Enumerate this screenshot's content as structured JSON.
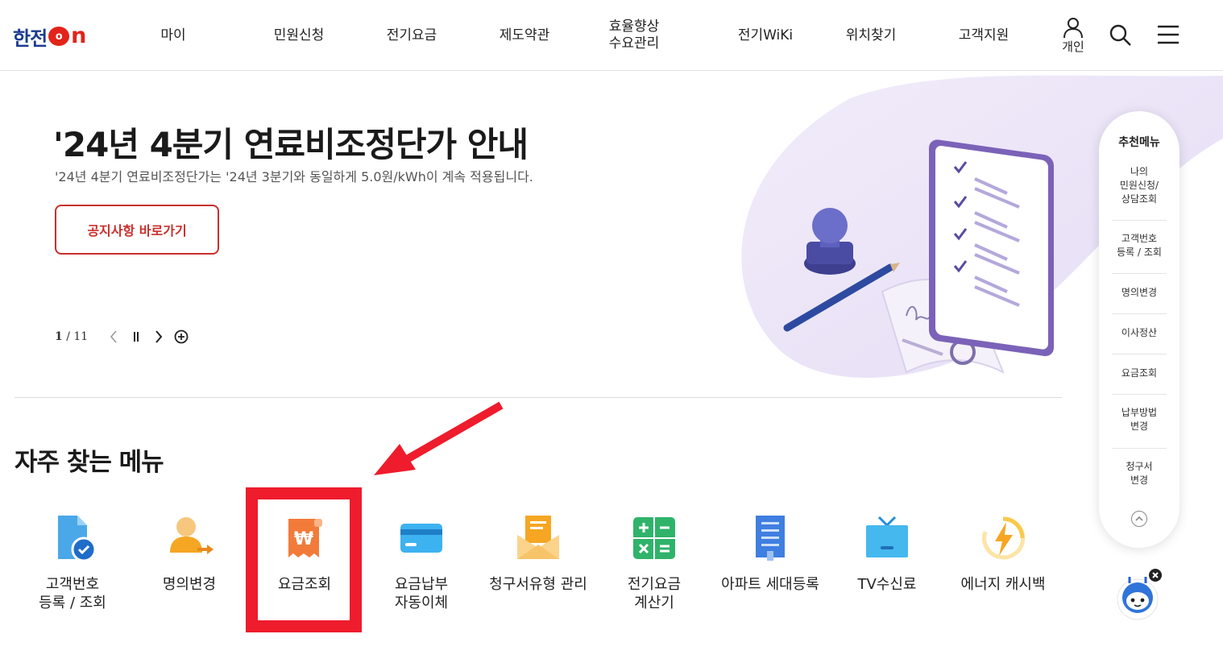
{
  "header": {
    "logo_text": "한전",
    "logo_on_o": "o",
    "logo_on_n": "n",
    "nav": [
      "마이",
      "민원신청",
      "전기요금",
      "제도약관",
      "효율향상\n수요관리",
      "전기WiKi",
      "위치찾기",
      "고객지원"
    ],
    "user_label": "개인",
    "icons": {
      "user": "user-icon",
      "search": "search-icon",
      "menu": "hamburger-menu-icon"
    }
  },
  "hero": {
    "title": "'24년 4분기 연료비조정단가 안내",
    "subtitle": "'24년 4분기 연료비조정단가는 '24년 3분기와 동일하게 5.0원/kWh이 계속 적용됩니다.",
    "button": "공지사항 바로가기",
    "pager": {
      "current": "1",
      "separator": "/",
      "total": "11"
    }
  },
  "quick_menu": {
    "title": "자주 찾는 메뉴",
    "items": [
      {
        "label": "고객번호\n등록 / 조회",
        "icon": "document-check-icon"
      },
      {
        "label": "명의변경",
        "icon": "person-transfer-icon"
      },
      {
        "label": "요금조회",
        "icon": "won-receipt-icon"
      },
      {
        "label": "요금납부\n자동이체",
        "icon": "credit-card-icon"
      },
      {
        "label": "청구서유형 관리",
        "icon": "envelope-icon"
      },
      {
        "label": "전기요금\n계산기",
        "icon": "calculator-icon"
      },
      {
        "label": "아파트 세대등록",
        "icon": "apartment-icon"
      },
      {
        "label": "TV수신료",
        "icon": "tv-icon"
      },
      {
        "label": "에너지 캐시백",
        "icon": "energy-bolt-icon"
      }
    ],
    "highlighted_index": 2
  },
  "rail": {
    "title": "추천메뉴",
    "items": [
      "나의\n민원신청/\n상담조회",
      "고객번호\n등록 / 조회",
      "명의변경",
      "이사정산",
      "요금조회",
      "납부방법\n변경",
      "청구서\n변경"
    ]
  },
  "colors": {
    "brand_blue": "#1b3c8f",
    "brand_red": "#e2241a",
    "button_red": "#c9302c",
    "annotation_red": "#ee1c2c"
  }
}
